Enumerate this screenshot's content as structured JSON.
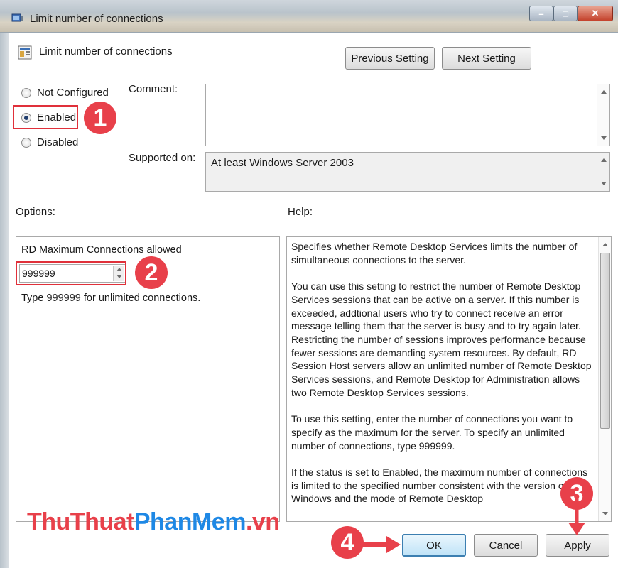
{
  "window": {
    "title": "Limit number of connections",
    "controls": {
      "minimize": "–",
      "maximize": "□",
      "close": "✕"
    }
  },
  "header": {
    "title": "Limit number of connections",
    "prev_button": "Previous Setting",
    "next_button": "Next Setting"
  },
  "state": {
    "options": [
      {
        "label": "Not Configured",
        "checked": false
      },
      {
        "label": "Enabled",
        "checked": true
      },
      {
        "label": "Disabled",
        "checked": false
      }
    ]
  },
  "comment": {
    "label": "Comment:",
    "value": ""
  },
  "supported": {
    "label": "Supported on:",
    "value": "At least Windows Server 2003"
  },
  "options_panel": {
    "label": "Options:",
    "field_label": "RD Maximum Connections allowed",
    "field_value": "999999",
    "hint": "Type 999999 for unlimited connections."
  },
  "help_panel": {
    "label": "Help:",
    "paragraphs": [
      "Specifies whether Remote Desktop Services limits the number of simultaneous connections to the server.",
      "You can use this setting to restrict the number of Remote Desktop Services sessions that can be active on a server. If this number is exceeded, addtional users who try to connect receive an error message telling them that the server is busy and to try again later. Restricting the number of sessions improves performance because fewer sessions are demanding system resources. By default, RD Session Host servers allow an unlimited number of Remote Desktop Services sessions, and Remote Desktop for Administration allows two Remote Desktop Services sessions.",
      "To use this setting, enter the number of connections you want to specify as the maximum for the server. To specify an unlimited number of connections, type 999999.",
      "If the status is set to Enabled, the maximum number of connections is limited to the specified number consistent with the version of Windows and the mode of Remote Desktop"
    ]
  },
  "footer": {
    "ok": "OK",
    "cancel": "Cancel",
    "apply": "Apply"
  },
  "callouts": [
    "1",
    "2",
    "3",
    "4"
  ],
  "watermark": {
    "part1": "ThuThuat",
    "part2": "PhanMem",
    "part3": ".vn"
  },
  "colors": {
    "callout": "#e8404a",
    "highlight": "#e0303a",
    "watermark_blue": "#1e88e5"
  },
  "icons": {
    "title": "policy-icon",
    "header": "setting-icon"
  }
}
